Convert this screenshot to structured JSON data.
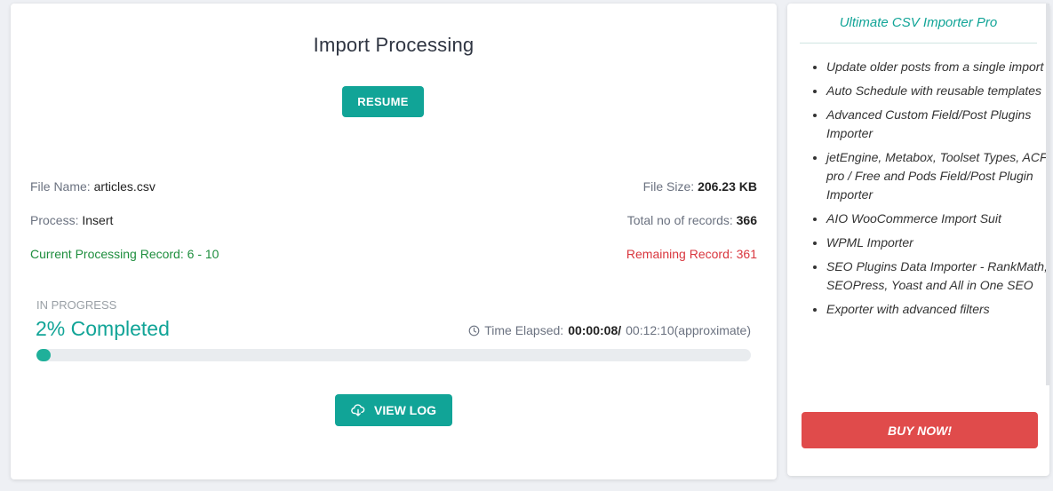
{
  "main": {
    "title": "Import Processing",
    "resume_label": "RESUME",
    "file_name_label": "File Name:",
    "file_name": "articles.csv",
    "file_size_label": "File Size:",
    "file_size": "206.23 KB",
    "process_label": "Process:",
    "process": "Insert",
    "total_records_label": "Total no of records:",
    "total_records": "366",
    "current_label": "Current Processing Record:",
    "current_range": "6 - 10",
    "remaining_label": "Remaining Record:",
    "remaining": "361",
    "status": "IN PROGRESS",
    "completed_text": "2% Completed",
    "progress_percent": 2,
    "time_elapsed_label": "Time Elapsed:",
    "time_elapsed": "00:00:08/",
    "time_estimate": "00:12:10(approximate)",
    "view_log_label": "VIEW LOG",
    "icons": {
      "clock": "clock-icon",
      "view_log": "cloud-download-icon"
    }
  },
  "sidebar": {
    "title": "Ultimate CSV Importer Pro",
    "features": [
      "Update older posts from a single import",
      "Auto Schedule with reusable templates",
      "Advanced Custom Field/Post Plugins Importer",
      "jetEngine, Metabox, Toolset Types, ACF pro / Free and Pods Field/Post Plugin Importer",
      "AIO WooCommerce Import Suit",
      "WPML Importer",
      "SEO Plugins Data Importer - RankMath, SEOPress, Yoast and All in One SEO",
      "Exporter with advanced filters"
    ],
    "buy_label": "BUY NOW!"
  },
  "colors": {
    "accent": "#11a497",
    "success": "#1e8e3e",
    "danger": "#d9363e",
    "buy": "#e04b4b"
  }
}
